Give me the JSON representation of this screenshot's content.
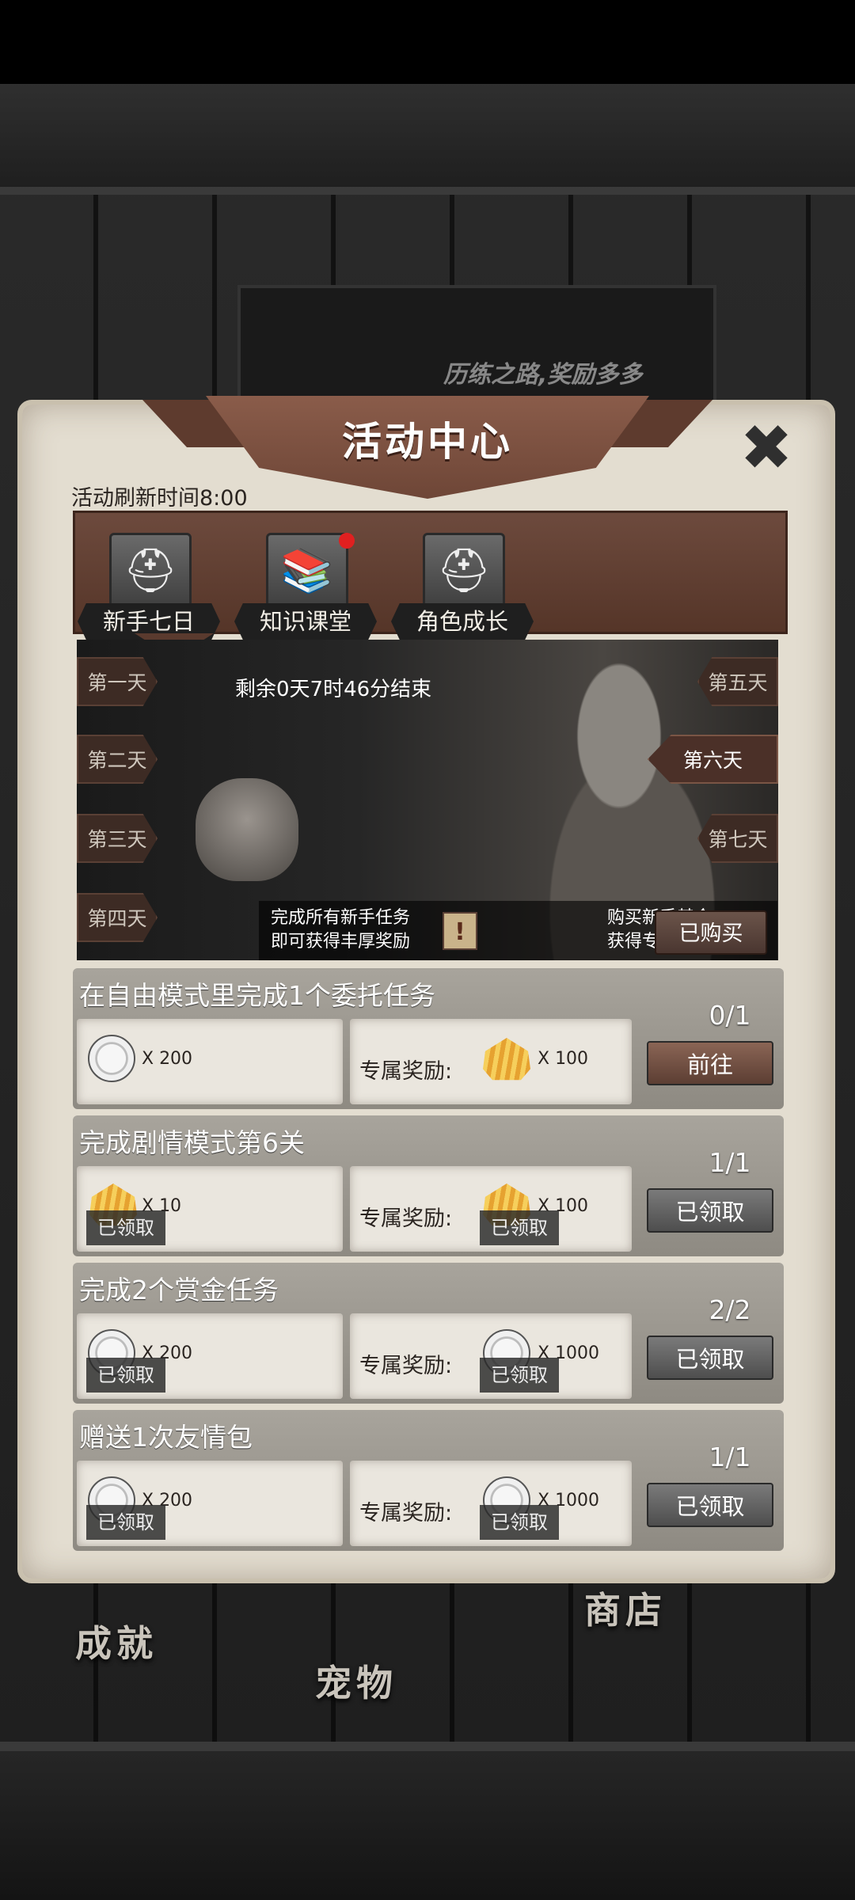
{
  "background": {
    "banner_text": "历练之路,奖励多多",
    "labels": [
      "成就",
      "宠物",
      "商店"
    ]
  },
  "panel": {
    "title": "活动中心",
    "close_symbol": "✖",
    "refresh_text": "活动刷新时间8:00"
  },
  "tabs": [
    {
      "label": "新手七日",
      "icon": "helmet-icon"
    },
    {
      "label": "知识课堂",
      "icon": "books-icon",
      "has_notification": true
    },
    {
      "label": "角色成长",
      "icon": "helmet-icon"
    }
  ],
  "hero": {
    "countdown": "剩余0天7时46分结束",
    "days_left": [
      "第一天",
      "第二天",
      "第三天",
      "第四天"
    ],
    "days_right": [
      "第五天",
      "第六天",
      "第七天"
    ],
    "active_day": "第六天",
    "caption_left_1": "完成所有新手任务",
    "caption_left_2": "即可获得丰厚奖励",
    "caption_right_1": "购买新手基金",
    "caption_right_2": "获得专属奖励",
    "info_symbol": "!",
    "bought_label": "已购买"
  },
  "tasks": [
    {
      "title": "在自由模式里完成1个委托任务",
      "reward_qty": "X 200",
      "exclusive_label": "专属奖励:",
      "exclusive_qty": "X 100",
      "progress": "0/1",
      "button": "前往",
      "claimed_tag": ""
    },
    {
      "title": "完成剧情模式第6关",
      "reward_qty": "X 10",
      "exclusive_label": "专属奖励:",
      "exclusive_qty": "X 100",
      "progress": "1/1",
      "button": "已领取",
      "claimed_tag": "已领取"
    },
    {
      "title": "完成2个赏金任务",
      "reward_qty": "X 200",
      "exclusive_label": "专属奖励:",
      "exclusive_qty": "X 1000",
      "progress": "2/2",
      "button": "已领取",
      "claimed_tag": "已领取"
    },
    {
      "title": "赠送1次友情包",
      "reward_qty": "X 200",
      "exclusive_label": "专属奖励:",
      "exclusive_qty": "X 1000",
      "progress": "1/1",
      "button": "已领取",
      "claimed_tag": "已领取"
    }
  ]
}
